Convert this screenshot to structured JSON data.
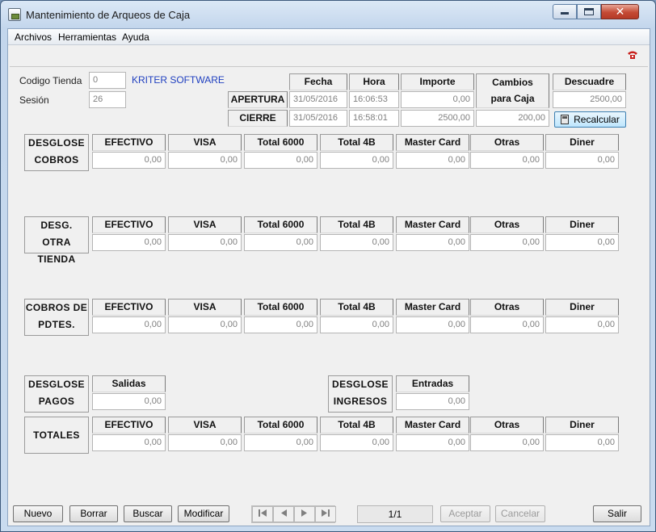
{
  "window": {
    "title": "Mantenimiento de Arqueos de Caja",
    "close_glyph": "✕"
  },
  "menu": [
    "Archivos",
    "Herramientas",
    "Ayuda"
  ],
  "header": {
    "codigo_tienda_label": "Codigo Tienda",
    "codigo_tienda_value": "0",
    "tienda_name": "KRITER SOFTWARE",
    "sesion_label": "Sesión",
    "sesion_value": "26"
  },
  "caja": {
    "col_fecha": "Fecha",
    "col_hora": "Hora",
    "col_importe": "Importe",
    "col_cambios": "Cambios",
    "col_cambios2": "para Caja",
    "col_descuadre": "Descuadre",
    "apertura_label": "APERTURA",
    "cierre_label": "CIERRE",
    "apertura": {
      "fecha": "31/05/2016",
      "hora": "16:06:53",
      "importe": "0,00"
    },
    "cierre": {
      "fecha": "31/05/2016",
      "hora": "16:58:01",
      "importe": "2500,00",
      "cambios": "200,00"
    },
    "descuadre": "2500,00",
    "recalcular": "Recalcular"
  },
  "columns": [
    "EFECTIVO",
    "VISA",
    "Total 6000",
    "Total 4B",
    "Master Card",
    "Otras",
    "Diner"
  ],
  "sections": {
    "desglose_cobros": {
      "line1": "DESGLOSE",
      "line2": "COBROS",
      "values": [
        "0,00",
        "0,00",
        "0,00",
        "0,00",
        "0,00",
        "0,00",
        "0,00"
      ]
    },
    "desg_otra_tienda": {
      "line1": "DESG. OTRA",
      "line2": "TIENDA",
      "values": [
        "0,00",
        "0,00",
        "0,00",
        "0,00",
        "0,00",
        "0,00",
        "0,00"
      ]
    },
    "cobros_pdtes": {
      "line1": "COBROS DE",
      "line2": "PDTES.",
      "values": [
        "0,00",
        "0,00",
        "0,00",
        "0,00",
        "0,00",
        "0,00",
        "0,00"
      ]
    },
    "totales": {
      "line1": "TOTALES",
      "values": [
        "0,00",
        "0,00",
        "0,00",
        "0,00",
        "0,00",
        "0,00",
        "0,00"
      ]
    }
  },
  "pagos": {
    "line1": "DESGLOSE",
    "line2": "PAGOS",
    "col": "Salidas",
    "value": "0,00"
  },
  "ingresos": {
    "line1": "DESGLOSE",
    "line2": "INGRESOS",
    "col": "Entradas",
    "value": "0,00"
  },
  "buttons": {
    "nuevo": "Nuevo",
    "borrar": "Borrar",
    "buscar": "Buscar",
    "modificar": "Modificar",
    "aceptar": "Aceptar",
    "cancelar": "Cancelar",
    "salir": "Salir"
  },
  "pager": "1/1",
  "icons": {
    "app": "app-icon",
    "help": "help-phone-icon",
    "calculator": "calculator-icon",
    "nav": [
      "first-record-icon",
      "prev-record-icon",
      "next-record-icon",
      "last-record-icon"
    ]
  }
}
